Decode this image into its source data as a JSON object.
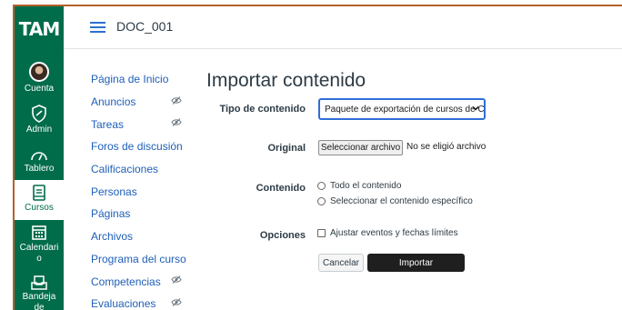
{
  "brand": {
    "logo_text": "TAM",
    "nav_color": "#006c4a",
    "link_color": "#1f5fb8",
    "accent": "#2f6fd6"
  },
  "global_nav": {
    "items": [
      {
        "label": "Cuenta",
        "icon": "avatar"
      },
      {
        "label": "Admin",
        "icon": "shield-icon"
      },
      {
        "label": "Tablero",
        "icon": "dashboard-icon"
      },
      {
        "label": "Cursos",
        "icon": "courses-icon",
        "active": true
      },
      {
        "label": "Calendario",
        "icon": "calendar-icon"
      },
      {
        "label": "Bandeja de",
        "icon": "inbox-icon"
      }
    ]
  },
  "header": {
    "breadcrumb": "DOC_001"
  },
  "course_nav": {
    "items": [
      {
        "label": "Página de Inicio"
      },
      {
        "label": "Anuncios",
        "hidden_icon": "eye-slash-icon"
      },
      {
        "label": "Tareas",
        "hidden_icon": "eye-slash-icon"
      },
      {
        "label": "Foros de discusión"
      },
      {
        "label": "Calificaciones"
      },
      {
        "label": "Personas"
      },
      {
        "label": "Páginas"
      },
      {
        "label": "Archivos"
      },
      {
        "label": "Programa del curso"
      },
      {
        "label": "Competencias",
        "hidden_icon": "eye-slash-icon"
      },
      {
        "label": "Evaluaciones",
        "hidden_icon": "eye-slash-icon"
      }
    ]
  },
  "main": {
    "title": "Importar contenido",
    "content_type": {
      "label": "Tipo de contenido",
      "selected": "Paquete de exportación de cursos de C"
    },
    "original": {
      "label": "Original",
      "button": "Seleccionar archivo",
      "status": "No se eligió archivo"
    },
    "contenido": {
      "label": "Contenido",
      "options": [
        "Todo el contenido",
        "Seleccionar el contenido específico"
      ]
    },
    "opciones": {
      "label": "Opciones",
      "checkbox": "Ajustar eventos y fechas límites"
    },
    "actions": {
      "cancel": "Cancelar",
      "import": "Importar"
    }
  }
}
